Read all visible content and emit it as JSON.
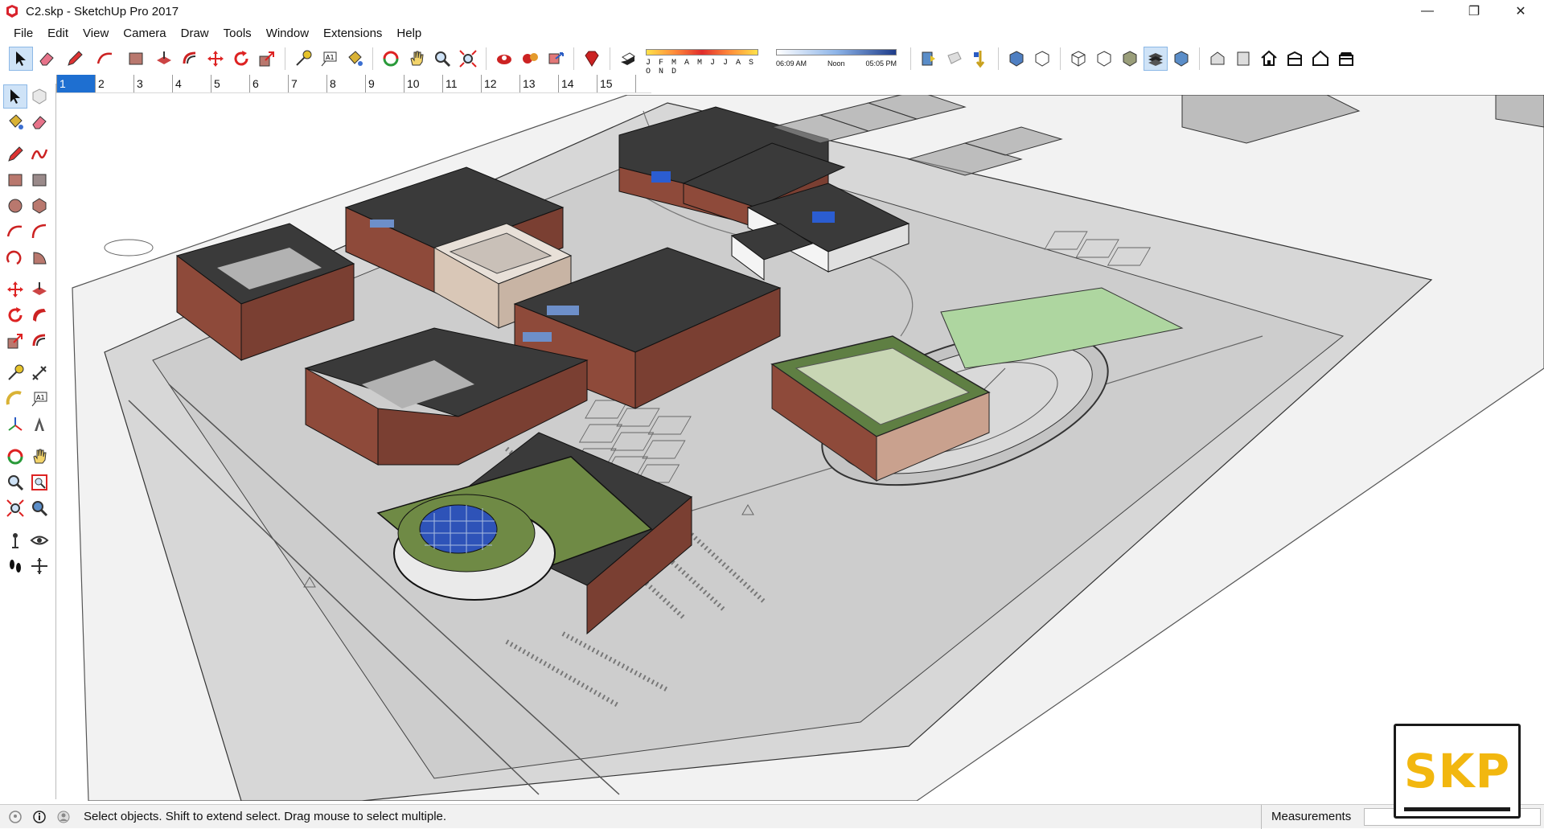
{
  "window": {
    "title": "C2.skp - SketchUp Pro 2017",
    "minimize": "—",
    "restore": "❐",
    "close": "✕"
  },
  "menu": [
    "File",
    "Edit",
    "View",
    "Camera",
    "Draw",
    "Tools",
    "Window",
    "Extensions",
    "Help"
  ],
  "shadows": {
    "months": "J F M A M J J A S O N D",
    "time_start": "06:09 AM",
    "time_mid": "Noon",
    "time_end": "05:05 PM"
  },
  "scenes": [
    "1",
    "2",
    "3",
    "4",
    "5",
    "6",
    "7",
    "8",
    "9",
    "10",
    "11",
    "12",
    "13",
    "14",
    "15"
  ],
  "active_scene": "1",
  "status": {
    "message": "Select objects. Shift to extend select. Drag mouse to select multiple.",
    "measurements_label": "Measurements",
    "measurements_value": ""
  },
  "badge": {
    "text": "SKP",
    "color": "#f2b70f"
  },
  "colors": {
    "accent": "#1e6fd1",
    "brick": "#8e4a3a",
    "roof": "#3a3a3a",
    "lawn": "#6f8a45",
    "ground": "#d7d7d7"
  }
}
